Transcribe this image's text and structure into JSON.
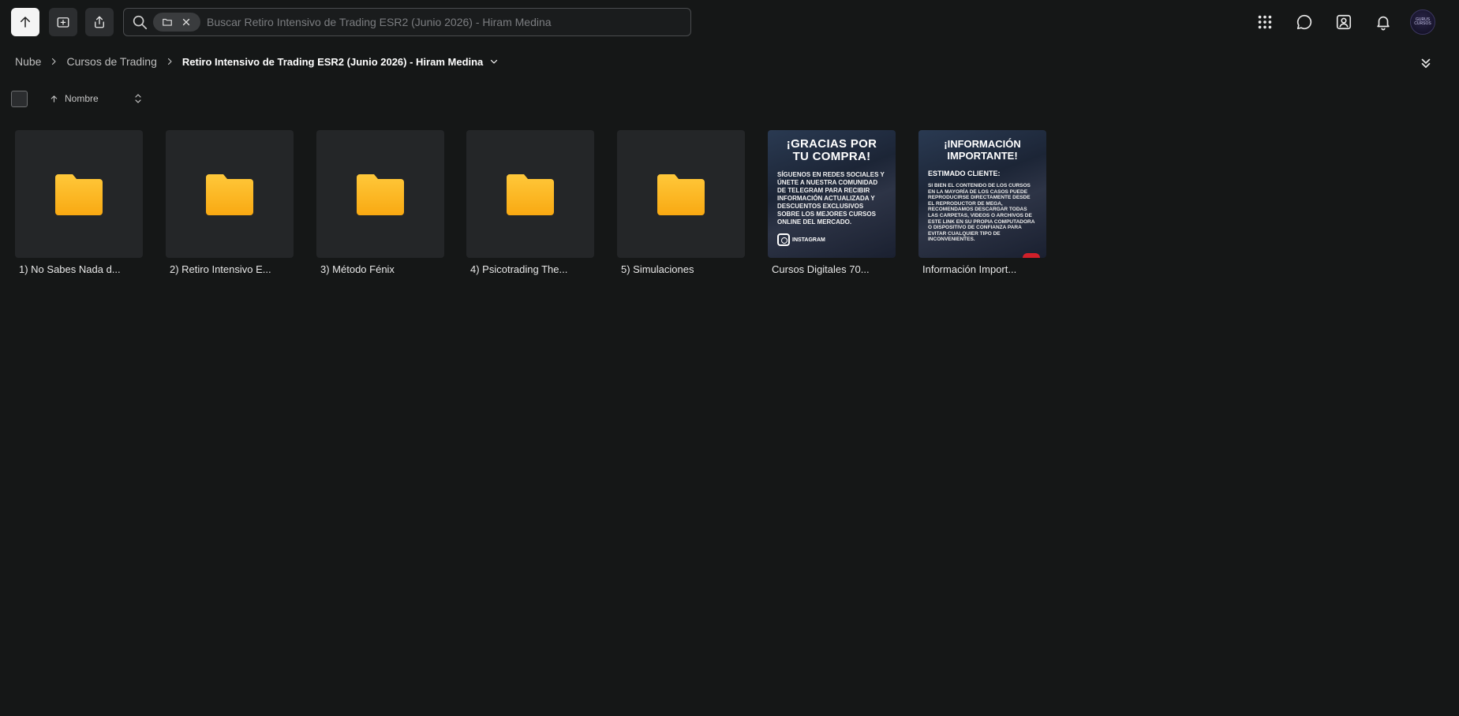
{
  "toolbar": {
    "upload_icon": "arrow-up-icon",
    "new_folder_icon": "folder-plus-icon",
    "share_icon": "share-icon"
  },
  "search": {
    "placeholder": "Buscar Retiro Intensivo de Trading ESR2 (Junio 2026) - Hiram Medina",
    "value": ""
  },
  "header_icons": [
    "apps-grid-icon",
    "chat-icon",
    "contacts-icon",
    "bell-icon"
  ],
  "avatar": {
    "text": "GURUS CURSOS"
  },
  "breadcrumb": {
    "items": [
      "Nube",
      "Cursos de Trading"
    ],
    "current": "Retiro Intensivo de Trading ESR2 (Junio 2026) - Hiram Medina"
  },
  "sort": {
    "label": "Nombre",
    "direction": "ascending"
  },
  "items": [
    {
      "name": "1) No Sabes Nada d...",
      "type": "folder"
    },
    {
      "name": "2) Retiro Intensivo E...",
      "type": "folder"
    },
    {
      "name": "3) Método Fénix",
      "type": "folder"
    },
    {
      "name": "4) Psicotrading The...",
      "type": "folder"
    },
    {
      "name": "5) Simulaciones",
      "type": "folder"
    },
    {
      "name": "Cursos Digitales 70...",
      "type": "image"
    },
    {
      "name": "Información Import...",
      "type": "image"
    }
  ],
  "thumb_gracias": {
    "title": "¡GRACIAS POR TU COMPRA!",
    "body": "SÍGUENOS EN REDES SOCIALES Y ÚNETE A NUESTRA COMUNIDAD DE TELEGRAM PARA RECIBIR INFORMACIÓN ACTUALIZADA Y DESCUENTOS EXCLUSIVOS SOBRE LOS MEJORES CURSOS ONLINE DEL MERCADO.",
    "instagram": "INSTAGRAM"
  },
  "thumb_info": {
    "title": "¡INFORMACIÓN IMPORTANTE!",
    "subtitle": "ESTIMADO CLIENTE:",
    "body": "SI BIEN EL CONTENIDO DE LOS CURSOS EN LA MAYORÍA DE LOS CASOS PUEDE REPRODUCIRSE DIRECTAMENTE DESDE EL REPRODUCTOR DE MEGA, RECOMENDAMOS DESCARGAR TODAS LAS CARPETAS, VIDEOS O ARCHIVOS DE ESTE LINK EN SU PROPIA COMPUTADORA O DISPOSITIVO DE CONFIANZA PARA EVITAR CUALQUIER TIPO DE INCONVENIENTES."
  },
  "colors": {
    "background": "#151717",
    "tile": "#242628",
    "folder": "#fbb81e",
    "primary_button": "#f4f4f4"
  }
}
